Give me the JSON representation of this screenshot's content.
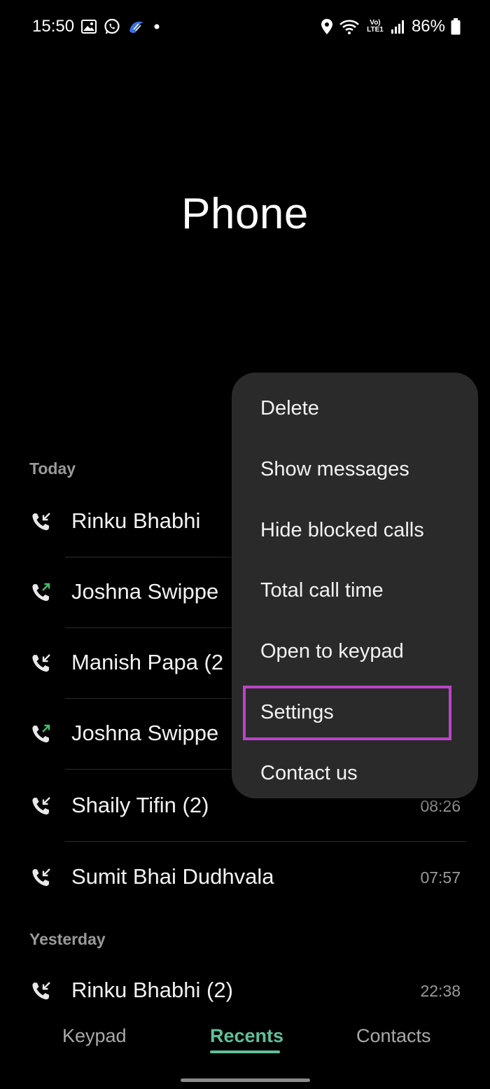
{
  "status_bar": {
    "time": "15:50",
    "battery": "86%",
    "network": "Vo) LTE1",
    "notification_icons": [
      "gallery-icon",
      "whatsapp-icon",
      "app-icon",
      "dot-icon"
    ],
    "status_icons": [
      "location-icon",
      "wifi-icon",
      "signal-icon",
      "battery-icon"
    ]
  },
  "page_title": "Phone",
  "sections": {
    "today": "Today",
    "yesterday": "Yesterday"
  },
  "calls": [
    {
      "name": "Rinku Bhabhi",
      "time": "",
      "type": "incoming",
      "icon": "incoming-call-icon"
    },
    {
      "name": "Joshna Swippe",
      "time": "",
      "type": "outgoing",
      "icon": "outgoing-call-icon"
    },
    {
      "name": "Manish Papa (2",
      "time": "",
      "type": "incoming",
      "icon": "incoming-call-icon"
    },
    {
      "name": "Joshna Swippe",
      "time": "",
      "type": "outgoing",
      "icon": "outgoing-call-icon"
    },
    {
      "name": "Shaily Tifin (2)",
      "time": "08:26",
      "type": "incoming",
      "icon": "incoming-call-icon"
    },
    {
      "name": "Sumit Bhai Dudhvala",
      "time": "07:57",
      "type": "incoming",
      "icon": "incoming-call-icon"
    }
  ],
  "yesterday_calls": [
    {
      "name": "Rinku Bhabhi (2)",
      "time": "22:38",
      "type": "incoming",
      "icon": "incoming-call-icon"
    }
  ],
  "menu": {
    "items": [
      {
        "label": "Delete"
      },
      {
        "label": "Show messages"
      },
      {
        "label": "Hide blocked calls"
      },
      {
        "label": "Total call time"
      },
      {
        "label": "Open to keypad"
      },
      {
        "label": "Settings",
        "highlighted": true
      },
      {
        "label": "Contact us"
      }
    ]
  },
  "tabs": [
    {
      "label": "Keypad",
      "active": false
    },
    {
      "label": "Recents",
      "active": true
    },
    {
      "label": "Contacts",
      "active": false
    }
  ],
  "colors": {
    "accent": "#5fc09a",
    "highlight": "#bb44c8",
    "outgoing_arrow": "#3fc06a",
    "menu_bg": "#2a2a2a",
    "secondary_text": "#9a9a9a"
  }
}
